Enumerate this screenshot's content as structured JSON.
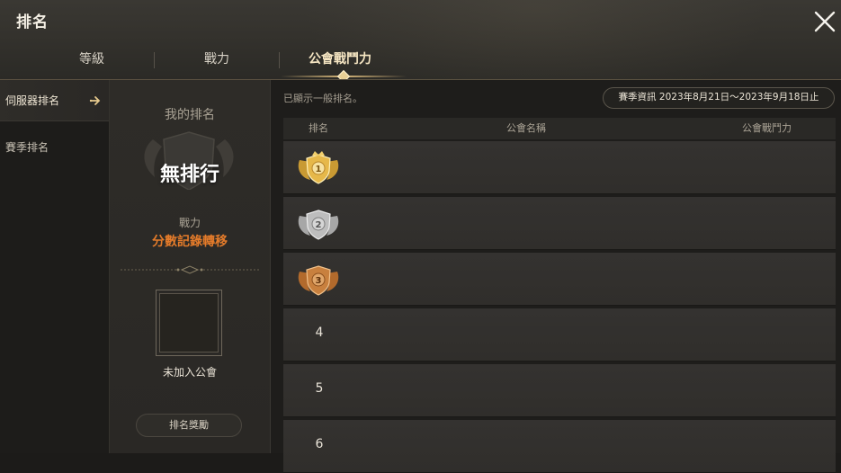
{
  "header": {
    "title": "排名",
    "tabs": [
      {
        "label": "等級",
        "active": false
      },
      {
        "label": "戰力",
        "active": false
      },
      {
        "label": "公會戰鬥力",
        "active": true
      }
    ]
  },
  "sidebar": {
    "items": [
      {
        "label": "伺服器排名",
        "active": true
      },
      {
        "label": "賽季排名",
        "active": false
      }
    ]
  },
  "my_rank": {
    "title": "我的排名",
    "rank_value": "無排行",
    "power_label": "戰力",
    "score_transfer": "分數記錄轉移",
    "guild_status": "未加入公會",
    "reward_button": "排名獎勵"
  },
  "main": {
    "notice": "已顯示一般排名。",
    "season_info": "賽季資訊 2023年8月21日～2023年9月18日止",
    "columns": [
      "排名",
      "公會名稱",
      "公會戰鬥力"
    ],
    "rows": [
      {
        "rank": "1",
        "medal": "gold"
      },
      {
        "rank": "2",
        "medal": "silver"
      },
      {
        "rank": "3",
        "medal": "bronze"
      },
      {
        "rank": "4"
      },
      {
        "rank": "5"
      },
      {
        "rank": "6"
      }
    ]
  },
  "colors": {
    "accent_orange": "#e47b2a",
    "gold": "#e0b449",
    "silver": "#b9b9b9",
    "bronze": "#c07a3a"
  },
  "icons": [
    "close-icon",
    "arrow-right-icon",
    "shield-wings-emblem",
    "gold-medal-icon",
    "silver-medal-icon",
    "bronze-medal-icon"
  ]
}
